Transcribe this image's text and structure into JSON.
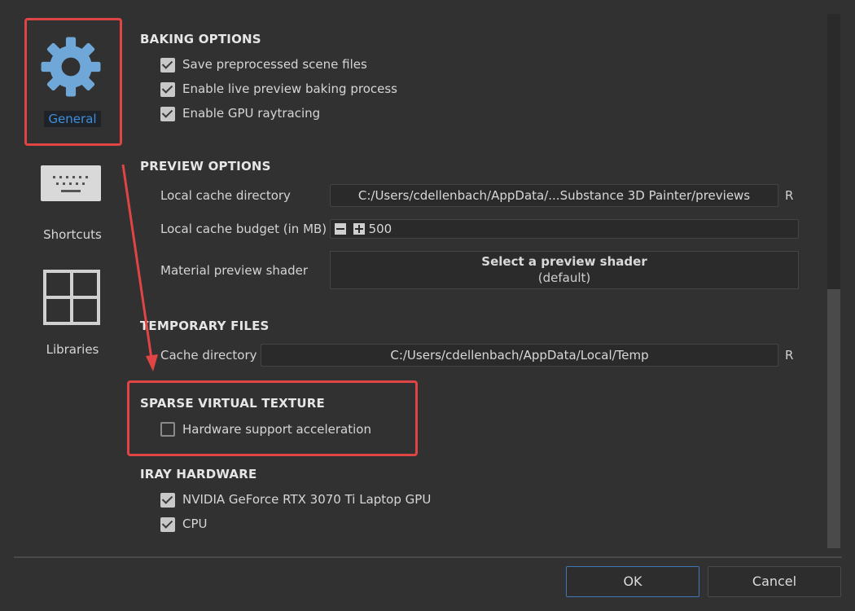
{
  "sidebar": {
    "items": [
      {
        "label": "General",
        "icon": "gear-icon",
        "active": true
      },
      {
        "label": "Shortcuts",
        "icon": "keyboard-icon",
        "active": false
      },
      {
        "label": "Libraries",
        "icon": "grid-icon",
        "active": false
      }
    ]
  },
  "baking": {
    "title": "BAKING OPTIONS",
    "options": [
      {
        "label": "Save preprocessed scene files",
        "checked": true
      },
      {
        "label": "Enable live preview baking process",
        "checked": true
      },
      {
        "label": "Enable GPU raytracing",
        "checked": true
      }
    ]
  },
  "preview": {
    "title": "PREVIEW OPTIONS",
    "cache_dir_label": "Local cache directory",
    "cache_dir_value": "C:/Users/cdellenbach/AppData/...Substance 3D Painter/previews",
    "cache_dir_reset": "R",
    "budget_label": "Local cache budget (in MB)",
    "budget_value": "500",
    "shader_label": "Material preview shader",
    "shader_button_title": "Select a preview shader",
    "shader_button_sub": "(default)"
  },
  "temp": {
    "title": "TEMPORARY FILES",
    "cache_dir_label": "Cache directory",
    "cache_dir_value": "C:/Users/cdellenbach/AppData/Local/Temp",
    "cache_dir_reset": "R"
  },
  "svt": {
    "title": "SPARSE VIRTUAL TEXTURE",
    "options": [
      {
        "label": "Hardware support acceleration",
        "checked": false
      }
    ]
  },
  "iray": {
    "title": "IRAY HARDWARE",
    "options": [
      {
        "label": "NVIDIA GeForce RTX 3070 Ti Laptop GPU",
        "checked": true
      },
      {
        "label": "CPU",
        "checked": true
      }
    ]
  },
  "footer": {
    "ok_label": "OK",
    "cancel_label": "Cancel"
  },
  "colors": {
    "background": "#313131",
    "accent_blue": "#3d8fe0",
    "annotation_red": "#e04545"
  }
}
